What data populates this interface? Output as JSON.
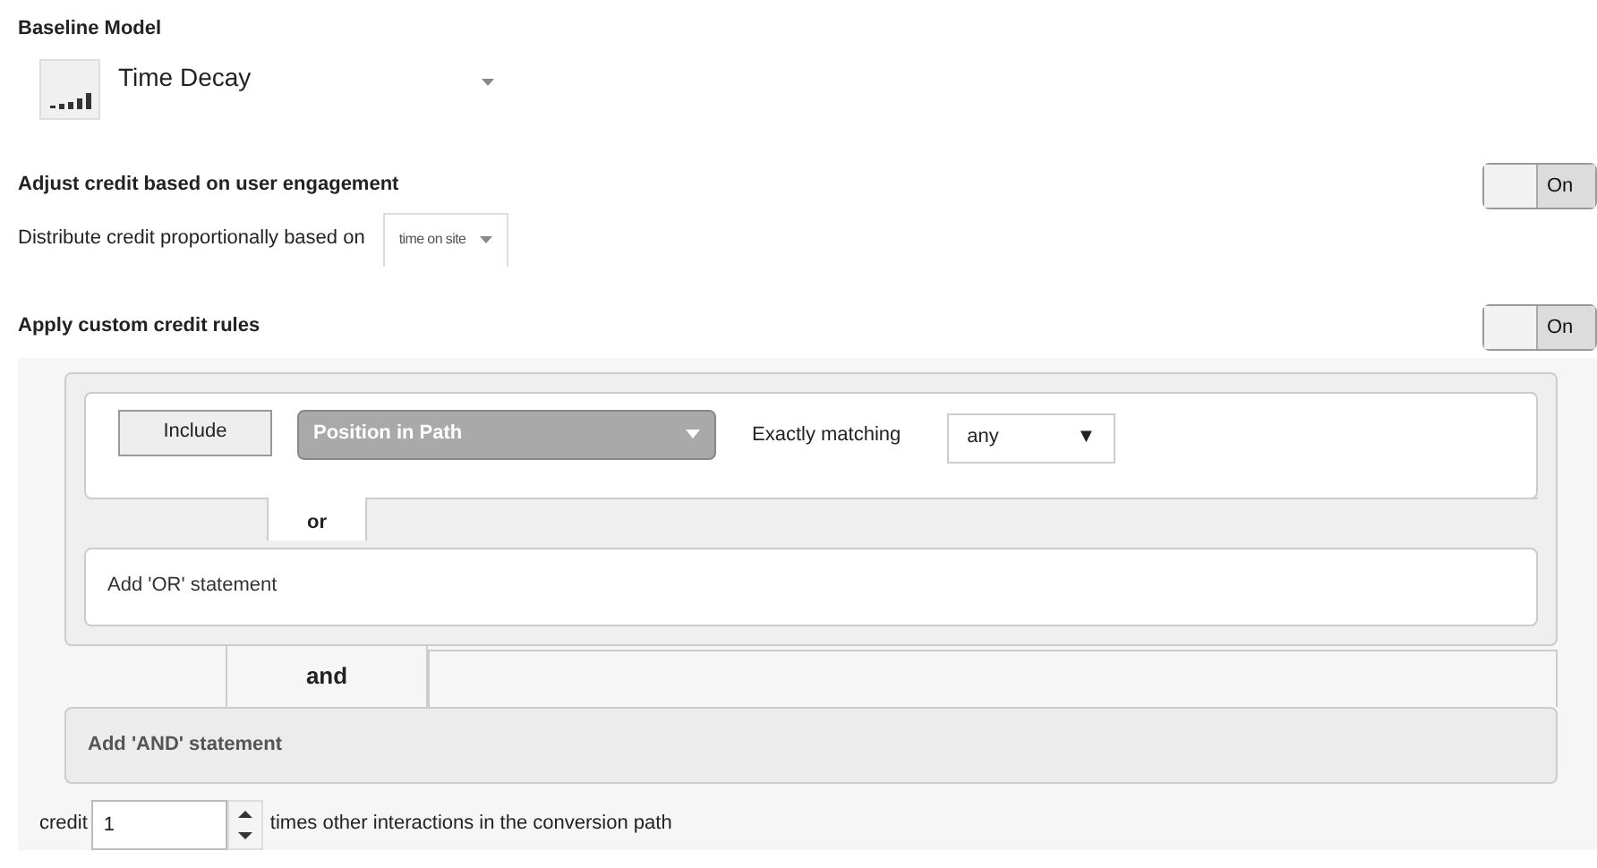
{
  "baseline": {
    "label": "Baseline Model",
    "model": "Time Decay"
  },
  "engagement": {
    "label": "Adjust credit based on user engagement",
    "toggle": {
      "on": true,
      "label": "On"
    },
    "distribute_label": "Distribute credit proportionally based on",
    "distribute_value": "time on site"
  },
  "custom_rules": {
    "label": "Apply custom credit rules",
    "toggle": {
      "on": true,
      "label": "On"
    },
    "condition": {
      "include": "Include",
      "dimension": "Position in Path",
      "operator": "Exactly matching",
      "value": "any",
      "value_arrow": "▼"
    },
    "or_label": "or",
    "add_or": "Add 'OR' statement",
    "and_label": "and",
    "add_and": "Add 'AND' statement",
    "credit_label": "credit",
    "credit_value": "1",
    "credit_suffix": "times other interactions in the conversion path"
  }
}
